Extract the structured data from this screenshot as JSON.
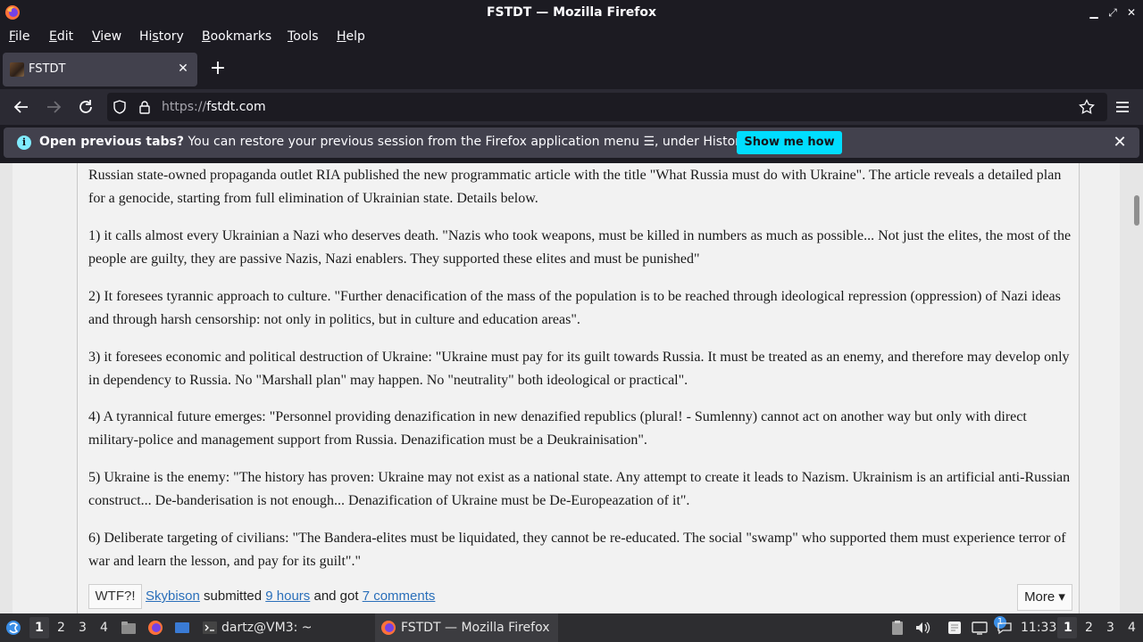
{
  "window": {
    "title": "FSTDT — Mozilla Firefox"
  },
  "menubar": {
    "items": [
      {
        "pre": "",
        "u": "F",
        "post": "ile"
      },
      {
        "pre": "",
        "u": "E",
        "post": "dit"
      },
      {
        "pre": "",
        "u": "V",
        "post": "iew"
      },
      {
        "pre": "Hi",
        "u": "s",
        "post": "tory"
      },
      {
        "pre": "",
        "u": "B",
        "post": "ookmarks"
      },
      {
        "pre": "",
        "u": "T",
        "post": "ools"
      },
      {
        "pre": "",
        "u": "H",
        "post": "elp"
      }
    ]
  },
  "tabs": [
    {
      "title": "FSTDT"
    }
  ],
  "urlbar": {
    "scheme": "https://",
    "host": "fstdt.com"
  },
  "notification": {
    "bold": "Open previous tabs?",
    "text": " You can restore your previous session from the Firefox application menu ",
    "menu_glyph": "☰",
    "tail": ", under History.",
    "button": "Show me how"
  },
  "post": {
    "paragraphs": [
      "Russian state-owned propaganda outlet RIA published the new programmatic article with the title \"What Russia must do with Ukraine\". The article reveals a detailed plan for a genocide, starting from full elimination of Ukrainian state. Details below.",
      "1) it calls almost every Ukrainian a Nazi who deserves death. \"Nazis who took weapons, must be killed in numbers as much as possible... Not just the elites, the most of the people are guilty, they are passive Nazis, Nazi enablers. They supported these elites and must be punished\"",
      "2) It foresees tyrannic approach to culture. \"Further denacification of the mass of the population is to be reached through ideological repression (oppression) of Nazi ideas and through harsh censorship: not only in politics, but in culture and education areas\".",
      "3) it foresees economic and political destruction of Ukraine: \"Ukraine must pay for its guilt towards Russia. It must be treated as an enemy, and therefore may develop only in dependency to Russia. No \"Marshall plan\" may happen. No \"neutrality\" both ideological or practical\".",
      "4) A tyrannical future emerges: \"Personnel providing denazification in new denazified republics (plural! - Sumlenny) cannot act on another way but only with direct military-police and management support from Russia. Denazification must be a Deukrainisation\".",
      "5) Ukraine is the enemy: \"The history has proven: Ukraine may not exist as a national state. Any attempt to create it leads to Nazism. Ukrainism is an artificial anti-Russian construct... De-banderisation is not enough... Denazification of Ukraine must be De-Europeazation of it\".",
      "6) Deliberate targeting of civilians: \"The Bandera-elites must be liquidated, they cannot be re-educated. The social \"swamp\" who supported them must experience terror of war and learn the lesson, and pay for its guilt\".\""
    ],
    "footer": {
      "wtf_button": "WTF?!",
      "author": "Skybison",
      "submitted_text": "submitted",
      "time": "9 hours",
      "and_got_text": "and got",
      "comments": "7 comments",
      "more_button": "More ▾"
    }
  },
  "taskbar": {
    "workspaces_left": [
      "1",
      "2",
      "3",
      "4"
    ],
    "terminal_task": "dartz@VM3: ~",
    "firefox_task": "FSTDT — Mozilla Firefox",
    "notification_count": "1",
    "clock": "11:33",
    "workspaces_right": [
      "1",
      "2",
      "3",
      "4"
    ]
  },
  "colors": {
    "accent": "#00ddff",
    "link": "#2a6fba",
    "chrome_dark": "#1c1b22"
  }
}
